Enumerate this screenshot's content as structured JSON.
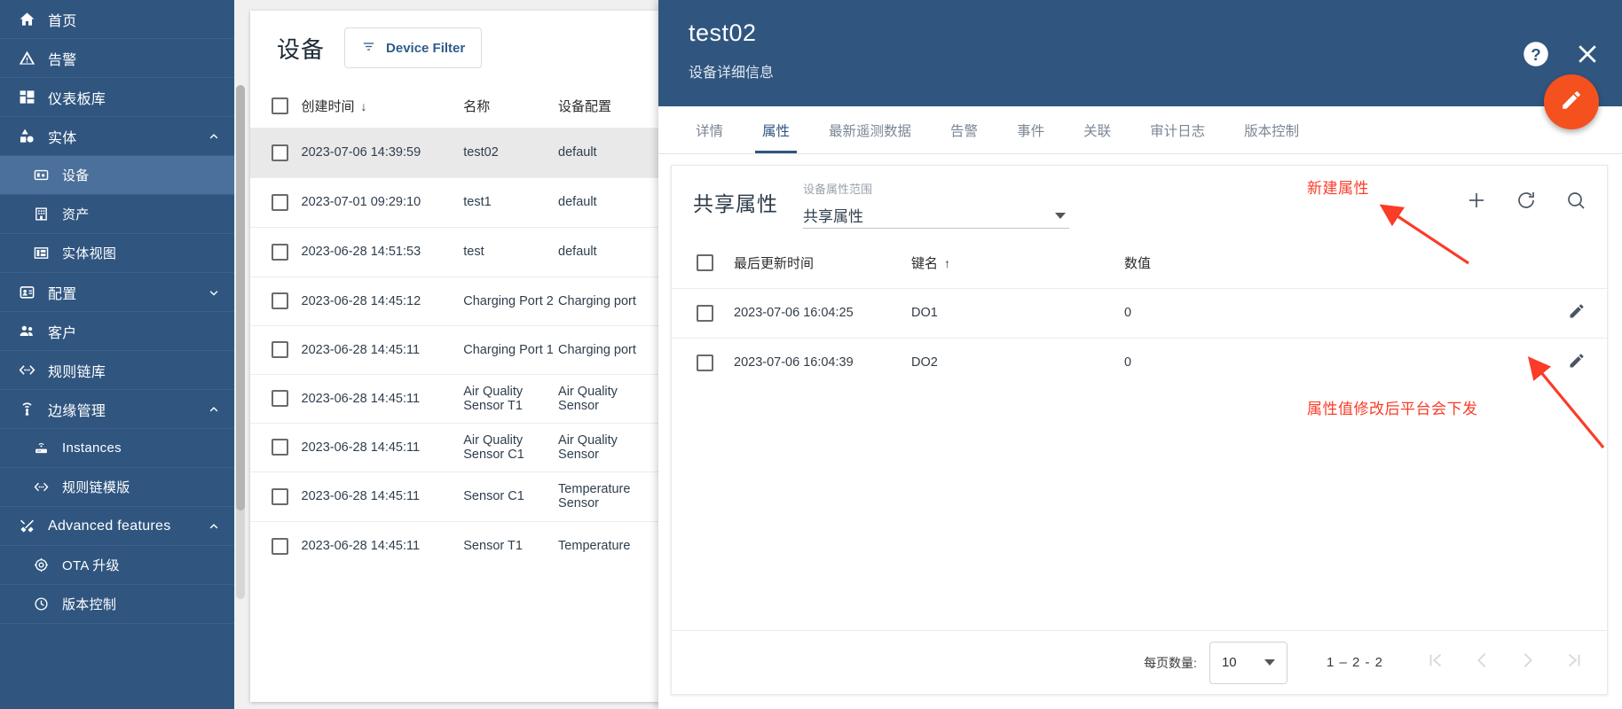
{
  "sidebar": {
    "items": [
      {
        "label": "首页",
        "icon": "home-icon",
        "level": 0,
        "active": false,
        "chevron": ""
      },
      {
        "label": "告警",
        "icon": "alarm-icon",
        "level": 0,
        "active": false,
        "chevron": ""
      },
      {
        "label": "仪表板库",
        "icon": "dashboard-icon",
        "level": 0,
        "active": false,
        "chevron": ""
      },
      {
        "label": "实体",
        "icon": "entity-icon",
        "level": 0,
        "active": false,
        "chevron": "up"
      },
      {
        "label": "设备",
        "icon": "device-icon",
        "level": 1,
        "active": true,
        "chevron": ""
      },
      {
        "label": "资产",
        "icon": "asset-icon",
        "level": 1,
        "active": false,
        "chevron": ""
      },
      {
        "label": "实体视图",
        "icon": "entityview-icon",
        "level": 1,
        "active": false,
        "chevron": ""
      },
      {
        "label": "配置",
        "icon": "profile-icon",
        "level": 0,
        "active": false,
        "chevron": "down"
      },
      {
        "label": "客户",
        "icon": "customer-icon",
        "level": 0,
        "active": false,
        "chevron": ""
      },
      {
        "label": "规则链库",
        "icon": "rulechain-icon",
        "level": 0,
        "active": false,
        "chevron": ""
      },
      {
        "label": "边缘管理",
        "icon": "edge-icon",
        "level": 0,
        "active": false,
        "chevron": "up"
      },
      {
        "label": "Instances",
        "icon": "router-icon",
        "level": 1,
        "active": false,
        "chevron": ""
      },
      {
        "label": "规则链模版",
        "icon": "rulechain-icon",
        "level": 1,
        "active": false,
        "chevron": ""
      },
      {
        "label": "Advanced features",
        "icon": "tools-icon",
        "level": 0,
        "active": false,
        "chevron": "up"
      },
      {
        "label": "OTA 升级",
        "icon": "ota-icon",
        "level": 1,
        "active": false,
        "chevron": ""
      },
      {
        "label": "版本控制",
        "icon": "version-icon",
        "level": 1,
        "active": false,
        "chevron": ""
      }
    ]
  },
  "device_list": {
    "title": "设备",
    "filter_button": "Device Filter",
    "columns": [
      "创建时间",
      "名称",
      "设备配置"
    ],
    "sort_column": "创建时间",
    "sort_direction": "desc",
    "rows": [
      {
        "time": "2023-07-06 14:39:59",
        "name": "test02",
        "profile": "default",
        "selected": true
      },
      {
        "time": "2023-07-01 09:29:10",
        "name": "test1",
        "profile": "default",
        "selected": false
      },
      {
        "time": "2023-06-28 14:51:53",
        "name": "test",
        "profile": "default",
        "selected": false
      },
      {
        "time": "2023-06-28 14:45:12",
        "name": "Charging Port 2",
        "profile": "Charging port",
        "selected": false
      },
      {
        "time": "2023-06-28 14:45:11",
        "name": "Charging Port 1",
        "profile": "Charging port",
        "selected": false
      },
      {
        "time": "2023-06-28 14:45:11",
        "name": "Air Quality Sensor T1",
        "profile": "Air Quality Sensor",
        "selected": false
      },
      {
        "time": "2023-06-28 14:45:11",
        "name": "Air Quality Sensor C1",
        "profile": "Air Quality Sensor",
        "selected": false
      },
      {
        "time": "2023-06-28 14:45:11",
        "name": "Sensor C1",
        "profile": "Temperature Sensor",
        "selected": false
      },
      {
        "time": "2023-06-28 14:45:11",
        "name": "Sensor T1",
        "profile": "Temperature",
        "selected": false
      }
    ]
  },
  "detail": {
    "title": "test02",
    "subtitle": "设备详细信息",
    "tabs": [
      {
        "label": "详情",
        "active": false
      },
      {
        "label": "属性",
        "active": true
      },
      {
        "label": "最新遥测数据",
        "active": false
      },
      {
        "label": "告警",
        "active": false
      },
      {
        "label": "事件",
        "active": false
      },
      {
        "label": "关联",
        "active": false
      },
      {
        "label": "审计日志",
        "active": false
      },
      {
        "label": "版本控制",
        "active": false
      }
    ]
  },
  "attributes": {
    "heading": "共享属性",
    "scope_label": "设备属性范围",
    "scope_value": "共享属性",
    "columns": [
      "最后更新时间",
      "键名",
      "数值"
    ],
    "sort_column": "键名",
    "sort_direction": "asc",
    "rows": [
      {
        "updated": "2023-07-06 16:04:25",
        "key": "DO1",
        "value": "0"
      },
      {
        "updated": "2023-07-06 16:04:39",
        "key": "DO2",
        "value": "0"
      }
    ],
    "pagination": {
      "label": "每页数量:",
      "page_size": "10",
      "range": "1 – 2 - 2"
    }
  },
  "annotations": [
    {
      "text": "新建属性",
      "id": "annotation-new-attribute"
    },
    {
      "text": "属性值修改后平台会下发",
      "id": "annotation-modify-attribute"
    }
  ],
  "colors": {
    "sidebar_bg": "#305680",
    "accent": "#305680",
    "fab": "#f4511e",
    "annotation": "#fa3c28"
  }
}
